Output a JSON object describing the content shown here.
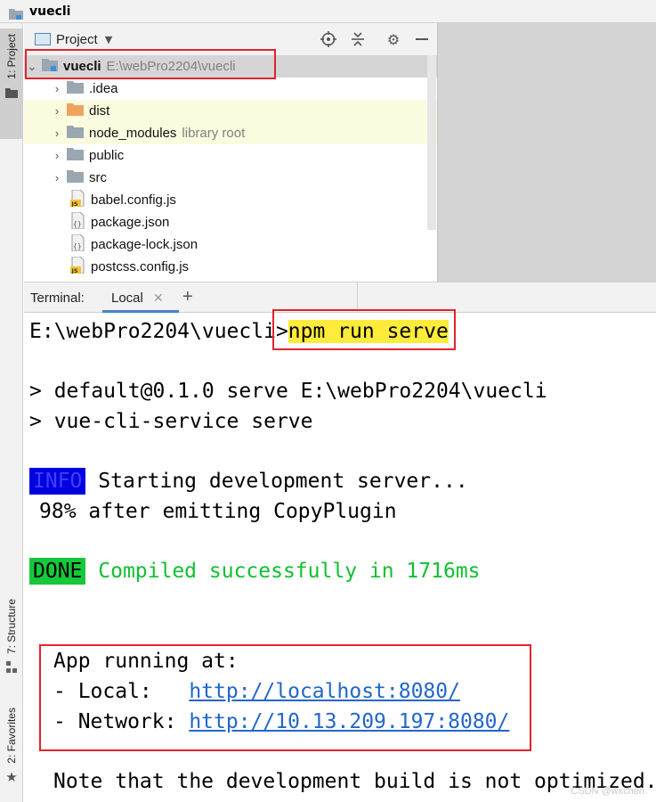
{
  "window": {
    "title": "vuecli"
  },
  "left_strip": {
    "project_tab": "1: Project",
    "structure_tab": "7: Structure",
    "favorites_tab": "2: Favorites"
  },
  "project_panel": {
    "title": "Project",
    "root": {
      "name": "vuecli",
      "path": "E:\\webPro2204\\vuecli"
    },
    "items": [
      {
        "name": ".idea",
        "type": "folder",
        "sub": ""
      },
      {
        "name": "dist",
        "type": "folder-excluded",
        "sub": ""
      },
      {
        "name": "node_modules",
        "type": "folder",
        "sub": "library root"
      },
      {
        "name": "public",
        "type": "folder",
        "sub": ""
      },
      {
        "name": "src",
        "type": "folder",
        "sub": ""
      },
      {
        "name": "babel.config.js",
        "type": "js"
      },
      {
        "name": "package.json",
        "type": "json"
      },
      {
        "name": "package-lock.json",
        "type": "json"
      },
      {
        "name": "postcss.config.js",
        "type": "js"
      }
    ]
  },
  "terminal": {
    "label": "Terminal:",
    "tab": "Local",
    "prompt": "E:\\webPro2204\\vuecli>",
    "command": "npm run serve",
    "lines": {
      "script1": "> default@0.1.0 serve E:\\webPro2204\\vuecli",
      "script2": "> vue-cli-service serve",
      "info_badge": "INFO",
      "info_text": "Starting development server...",
      "progress": "98% after emitting CopyPlugin",
      "done_badge": "DONE",
      "done_text": "Compiled successfully in 1716ms",
      "app_running": "App running at:",
      "local_label": "- Local:   ",
      "local_url": "http://localhost:8080/",
      "network_label": "- Network: ",
      "network_url": "http://10.13.209.197:8080/",
      "note": "Note that the development build is not optimized."
    }
  },
  "watermark": "CSDN @wxchen.",
  "colors": {
    "highlight_yellow": "#ffeb3b",
    "info_blue": "#0000e0",
    "done_green": "#16c93a",
    "success_text": "#10c030",
    "link": "#2266cc",
    "annotation_red": "#e0242c",
    "tab_underline": "#4083c9"
  }
}
